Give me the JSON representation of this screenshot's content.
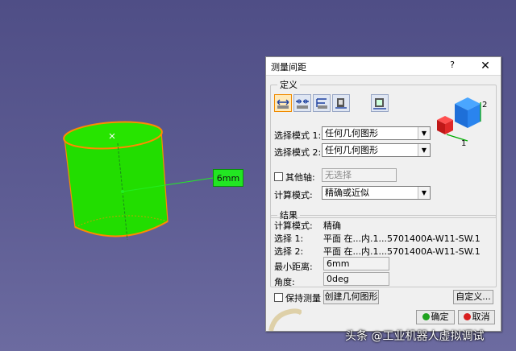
{
  "viewport": {
    "measurement_tag": "6mm",
    "part_color": "#22dd00",
    "edge_highlight_color": "#ff8a00"
  },
  "dialog": {
    "title": "测量间距",
    "help_label": "?",
    "close_label": "✕",
    "definition": {
      "legend": "定义",
      "toolbar_icons": [
        "measure-between-icon",
        "measure-in-chain-icon",
        "measure-fan-icon",
        "measure-item-icon",
        "measure-thickness-icon"
      ],
      "mode1_label": "选择模式 1:",
      "mode1_value": "任何几何图形",
      "mode2_label": "选择模式 2:",
      "mode2_value": "任何几何图形",
      "other_axis_label": "其他轴:",
      "other_axis_value": "无选择",
      "calc_mode_label": "计算模式:",
      "calc_mode_value": "精确或近似"
    },
    "results": {
      "legend": "结果",
      "calc_mode_label": "计算模式:",
      "calc_mode_value": "精确",
      "selection1_label": "选择 1:",
      "selection1_value": "平面 在...内.1...5701400A-W11-SW.1",
      "selection2_label": "选择 2:",
      "selection2_value": "平面 在...内.1...5701400A-W11-SW.1",
      "min_distance_label": "最小距离:",
      "min_distance_value": "6mm",
      "angle_label": "角度:",
      "angle_value": "0deg"
    },
    "keep_measure_label": "保持测量",
    "create_geometry_label": "创建几何图形",
    "customize_label": "自定义...",
    "ok_label": "确定",
    "cancel_label": "取消"
  },
  "watermark": "头条 @工业机器人虚拟调试"
}
